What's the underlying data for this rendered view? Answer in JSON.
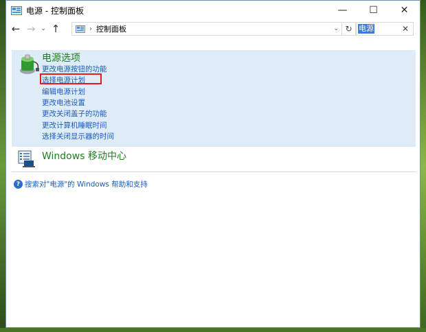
{
  "window": {
    "title": "电源 - 控制面板",
    "controls": {
      "minimize": "—",
      "maximize": "☐",
      "close": "✕"
    }
  },
  "addressbar": {
    "back": "←",
    "forward": "→",
    "recent": "⌄",
    "up": "↑",
    "separator": "›",
    "path": "控制面板",
    "dropdown": "⌄",
    "refresh": "↻"
  },
  "search": {
    "value": "电源",
    "clear": "✕"
  },
  "power_section": {
    "title": "电源选项",
    "tasks": [
      "更改电源按钮的功能",
      "选择电源计划",
      "编辑电源计划",
      "更改电池设置",
      "更改关闭盖子的功能",
      "更改计算机睡眠时间",
      "选择关闭显示器的时间"
    ]
  },
  "mobility_section": {
    "title": "Windows 移动中心"
  },
  "help": {
    "icon": "?",
    "text": "搜索对\"电源\"的 Windows 帮助和支持"
  },
  "colors": {
    "link": "#1a5bbf",
    "section_title": "#1e7e1e",
    "section_bg": "#deecf8",
    "highlight": "#e21b1b"
  }
}
